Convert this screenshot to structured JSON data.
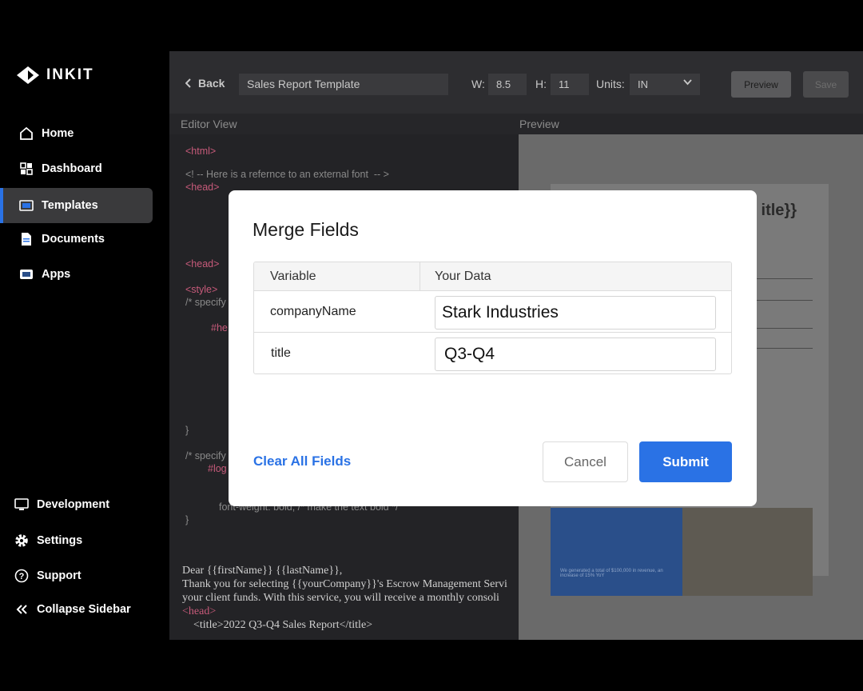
{
  "brand": {
    "name": "INKIT"
  },
  "sidebar": {
    "items": [
      {
        "label": "Home",
        "icon": "home-icon"
      },
      {
        "label": "Dashboard",
        "icon": "dashboard-icon"
      },
      {
        "label": "Templates",
        "icon": "templates-icon",
        "active": true
      },
      {
        "label": "Documents",
        "icon": "documents-icon"
      },
      {
        "label": "Apps",
        "icon": "apps-icon"
      }
    ],
    "bottom_items": [
      {
        "label": "Development",
        "icon": "monitor-icon"
      },
      {
        "label": "Settings",
        "icon": "gear-icon"
      },
      {
        "label": "Support",
        "icon": "help-icon"
      },
      {
        "label": "Collapse Sidebar",
        "icon": "double-chevron-left-icon"
      }
    ]
  },
  "toolbar": {
    "back_label": "Back",
    "template_name": "Sales Report Template",
    "width_label": "W:",
    "width_value": "8.5",
    "height_label": "H:",
    "height_value": "11",
    "units_label": "Units:",
    "units_value": "IN",
    "preview_label": "Preview",
    "save_label": "Save"
  },
  "panes": {
    "editor_label": "Editor View",
    "preview_label": "Preview"
  },
  "editor": {
    "lines": [
      "<html>",
      "<! -- Here is a refernce to an external font  -- >",
      "<head>",
      "<head>",
      "<style>",
      "/* specify",
      "#he",
      "}",
      "/* specify",
      "#log",
      "font-weight: bold; /* make the text bold */",
      "}",
      "Dear {{firstName}} {{lastName}},",
      "Thank you for selecting {{yourCompany}}'s Escrow Management Servi",
      "your client funds. With this service, you will receive a monthly consoli",
      "<head>",
      "<title>2022 Q3-Q4 Sales Report</title>"
    ]
  },
  "preview_doc": {
    "title_fragment": "itle}}",
    "banner_text": "We generated a total of $100,000 in revenue, an increase of 15% YoY"
  },
  "modal": {
    "title": "Merge Fields",
    "columns": [
      "Variable",
      "Your Data"
    ],
    "rows": [
      {
        "variable": "companyName",
        "value": "Stark Industries"
      },
      {
        "variable": "title",
        "value": "Q3-Q4"
      }
    ],
    "clear_label": "Clear All Fields",
    "cancel_label": "Cancel",
    "submit_label": "Submit"
  },
  "colors": {
    "accent": "#2a72e5",
    "sidebar_bg": "#000000",
    "editor_bg": "#232326"
  }
}
